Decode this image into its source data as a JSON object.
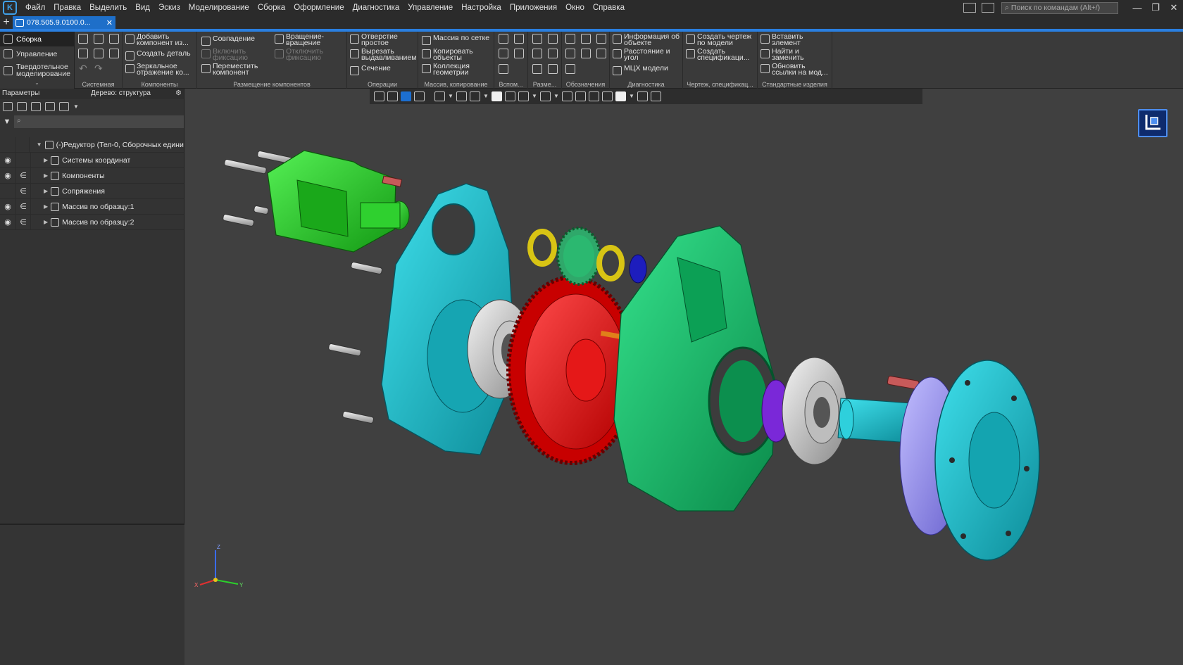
{
  "menu": [
    "Файл",
    "Правка",
    "Выделить",
    "Вид",
    "Эскиз",
    "Моделирование",
    "Сборка",
    "Оформление",
    "Диагностика",
    "Управление",
    "Настройка",
    "Приложения",
    "Окно",
    "Справка"
  ],
  "command_search": {
    "placeholder": "Поиск по командам (Alt+/)"
  },
  "document_tab": {
    "label": "078.505.9.0100.0..."
  },
  "modes": [
    {
      "label": "Сборка",
      "active": true
    },
    {
      "label": "Управление",
      "active": false
    },
    {
      "label": "Твердотельное моделирование",
      "active": false
    }
  ],
  "ribbon": {
    "groups": [
      "Системная",
      "Компоненты",
      "Размещение компонентов",
      "Операции",
      "Массив, копирование",
      "Вспом...",
      "Разме...",
      "Обозначения",
      "Диагностика",
      "Чертеж, спецификац...",
      "Стандартные изделия"
    ],
    "components": {
      "add": "Добавить компонент из...",
      "create_part": "Создать деталь",
      "mirror": "Зеркальное отражение ко..."
    },
    "placement": {
      "coincide": "Совпадение",
      "rotate": "Вращение-вращение",
      "enable_fix": "Включить фиксацию",
      "disable_fix": "Отключить фиксацию",
      "move": "Переместить компонент"
    },
    "operations": {
      "hole": "Отверстие простое",
      "extrude_cut": "Вырезать выдавливанием",
      "section": "Сечение"
    },
    "array": {
      "grid": "Массив по сетке",
      "copy": "Копировать объекты",
      "collection": "Коллекция геометрии"
    },
    "diagnostics": {
      "info": "Информация об объекте",
      "distance": "Расстояние и угол",
      "mass": "МЦХ модели"
    },
    "drawing": {
      "create_drawing": "Создать чертеж по модели",
      "create_spec": "Создать спецификаци..."
    },
    "standard": {
      "insert": "Вставить элемент",
      "find_replace": "Найти и заменить",
      "update_links": "Обновить ссылки на мод..."
    }
  },
  "panel": {
    "title": "Параметры",
    "tree_label": "Дерево: структура",
    "filter_placeholder": "",
    "rows": [
      {
        "label": "(-)Редуктор (Тел-0, Сборочных едини...",
        "eye": false,
        "link": false,
        "indent": 1
      },
      {
        "label": "Системы координат",
        "eye": true,
        "link": false,
        "indent": 2
      },
      {
        "label": "Компоненты",
        "eye": true,
        "link": true,
        "indent": 2
      },
      {
        "label": "Сопряжения",
        "eye": false,
        "link": true,
        "indent": 2
      },
      {
        "label": "Массив по образцу:1",
        "eye": true,
        "link": true,
        "indent": 2
      },
      {
        "label": "Массив по образцу:2",
        "eye": true,
        "link": true,
        "indent": 2
      }
    ]
  },
  "axes": {
    "x": "X",
    "y": "Y",
    "z": "Z"
  },
  "colors": {
    "accent": "#2a7fe0",
    "green_part": "#22c722",
    "cyan_part": "#1ab6c4",
    "red_gear": "#e01010",
    "green_housing": "#12b76a",
    "lavender_flange": "#9b95ee",
    "yellow_ring": "#e6d21a"
  }
}
